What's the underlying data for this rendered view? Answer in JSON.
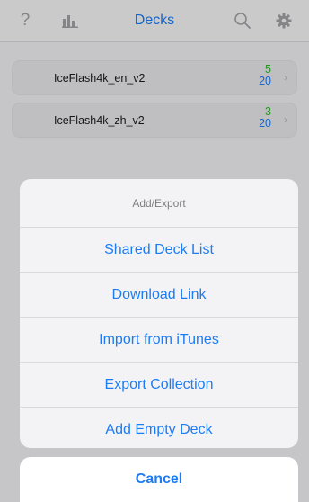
{
  "nav": {
    "help_glyph": "?",
    "title": "Decks",
    "icons": [
      "help-icon",
      "stats-icon",
      "search-icon",
      "settings-icon"
    ]
  },
  "decks": [
    {
      "name": "IceFlash4k_en_v2",
      "new": "5",
      "due": "20"
    },
    {
      "name": "IceFlash4k_zh_v2",
      "new": "3",
      "due": "20"
    }
  ],
  "sheet": {
    "title": "Add/Export",
    "items": [
      "Shared Deck List",
      "Download Link",
      "Import from iTunes",
      "Export Collection",
      "Add Empty Deck"
    ],
    "cancel": "Cancel"
  },
  "colors": {
    "accent": "#1c7cf4",
    "new": "#2fb52f",
    "due": "#1c7cf4"
  }
}
